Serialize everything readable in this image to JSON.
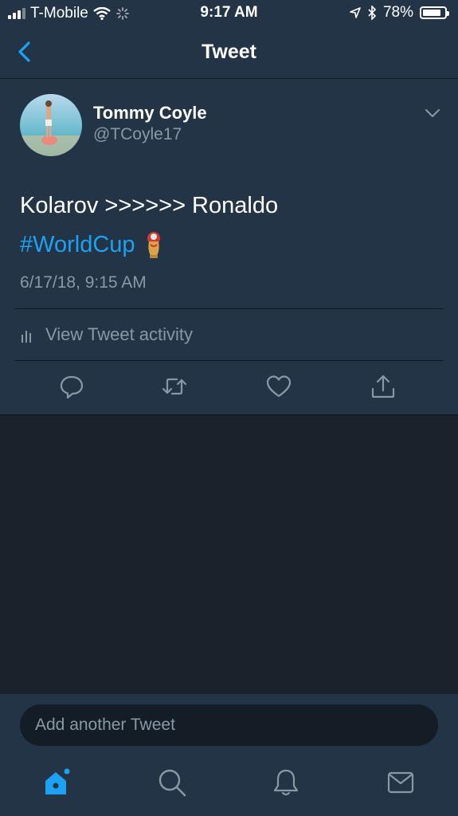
{
  "status_bar": {
    "carrier": "T-Mobile",
    "time": "9:17 AM",
    "battery": "78%",
    "battery_level": 0.78
  },
  "header": {
    "title": "Tweet"
  },
  "tweet": {
    "author_name": "Tommy Coyle",
    "author_handle": "@TCoyle17",
    "text": "Kolarov >>>>>> Ronaldo",
    "hashtag": "#WorldCup",
    "timestamp": "6/17/18, 9:15 AM",
    "activity_label": "View Tweet activity"
  },
  "composer": {
    "placeholder": "Add another Tweet"
  },
  "colors": {
    "background": "#1b222c",
    "card": "#243447",
    "accent": "#1da1f2",
    "secondary_text": "#8899a6"
  },
  "icons": [
    "back-chevron-icon",
    "chevron-down-icon",
    "bar-chart-icon",
    "reply-icon",
    "retweet-icon",
    "like-icon",
    "share-icon",
    "home-icon",
    "search-icon",
    "notifications-icon",
    "messages-icon",
    "world-cup-trophy-icon"
  ]
}
